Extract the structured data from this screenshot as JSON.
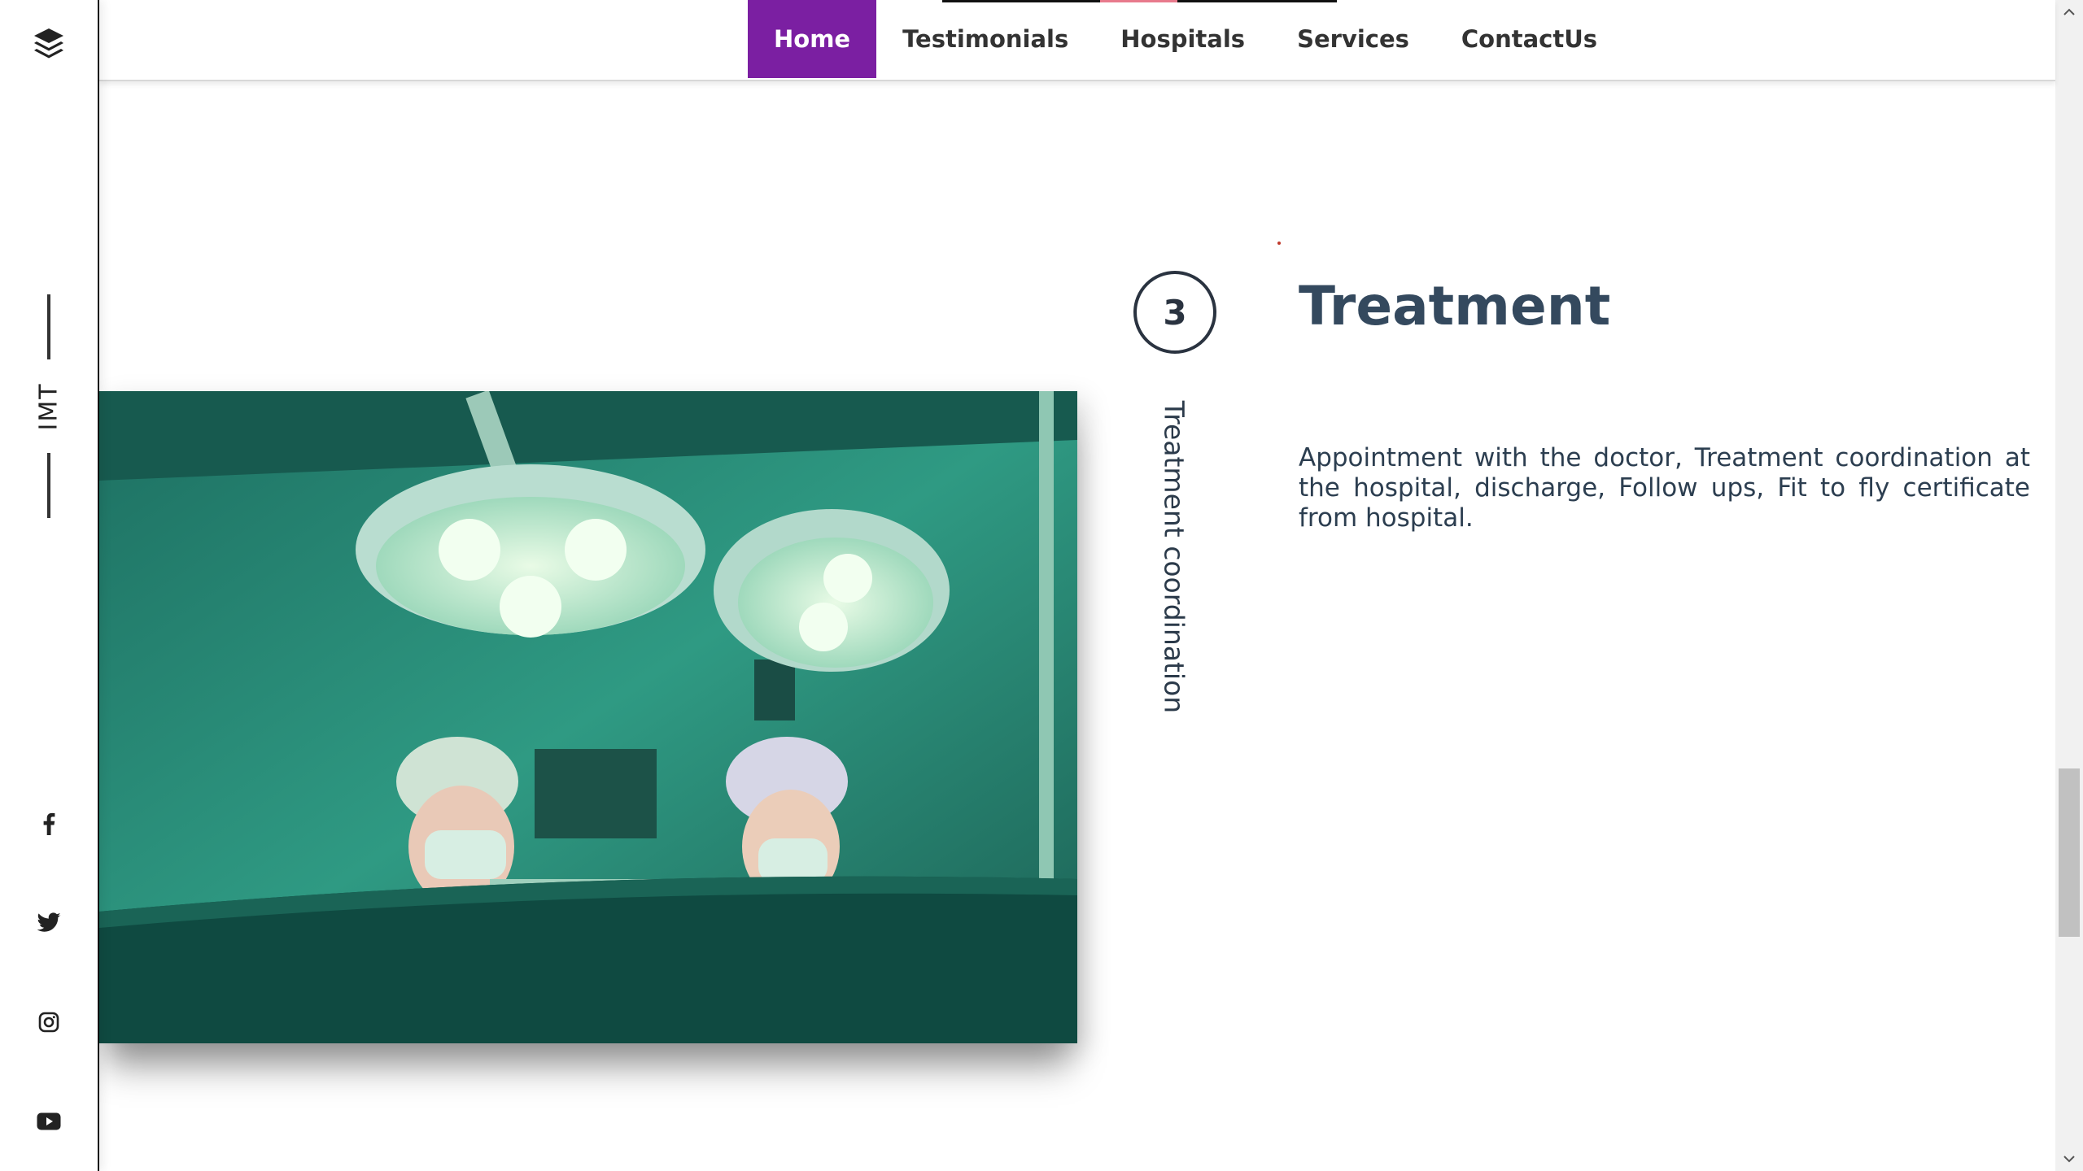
{
  "sidebar": {
    "logo_icon": "layers-icon",
    "brand": "IMT",
    "social": [
      {
        "name": "facebook",
        "icon": "facebook-icon"
      },
      {
        "name": "twitter",
        "icon": "twitter-icon"
      },
      {
        "name": "instagram",
        "icon": "instagram-icon"
      },
      {
        "name": "youtube",
        "icon": "youtube-icon"
      }
    ]
  },
  "nav": {
    "items": [
      {
        "label": "Home",
        "active": true
      },
      {
        "label": "Testimonials",
        "active": false
      },
      {
        "label": "Hospitals",
        "active": false
      },
      {
        "label": "Services",
        "active": false
      },
      {
        "label": "ContactUs",
        "active": false
      }
    ],
    "active_color": "#7b1fa2"
  },
  "step": {
    "number": "3",
    "vertical_label": "Treatment coordination",
    "title": "Treatment",
    "description": "Appointment with the doctor, Treatment coordination at the hospital, discharge, Follow ups, Fit to fly certificate from hospital."
  },
  "colors": {
    "heading": "#34495e",
    "text": "#2c3e50",
    "photo_tint": "#2c8a77"
  }
}
